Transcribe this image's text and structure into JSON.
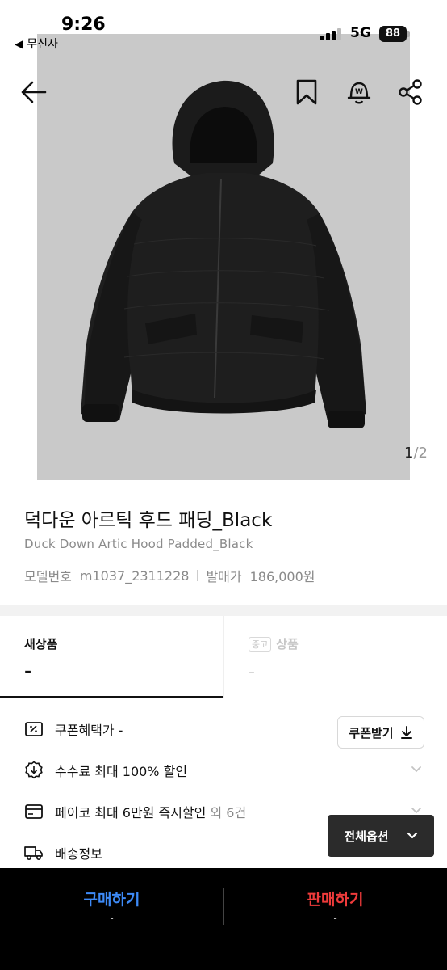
{
  "status_bar": {
    "time": "9:26",
    "back_app": "◀ 무신사",
    "network": "5G",
    "battery": "88"
  },
  "top_nav": {
    "back_icon": "arrow-left-icon",
    "bookmark_icon": "bookmark-icon",
    "alert_icon": "bell-w-icon",
    "share_icon": "share-icon"
  },
  "gallery": {
    "current": "1",
    "separator": "/",
    "total": "2"
  },
  "product": {
    "title": "덕다운 아르틱 후드 패딩_Black",
    "subtitle": "Duck Down Artic Hood Padded_Black",
    "model_label": "모델번호",
    "model_value": "m1037_2311228",
    "release_label": "발매가",
    "release_value": "186,000원"
  },
  "tabs": {
    "new": {
      "label": "새상품",
      "value": "-"
    },
    "used": {
      "tag": "중고",
      "label": "상품",
      "value": "-"
    }
  },
  "benefits": [
    {
      "icon": "coupon-icon",
      "text": "쿠폰혜택가 -",
      "extra": ""
    },
    {
      "icon": "discount-badge-icon",
      "text": "수수료 최대 100% 할인",
      "extra": ""
    },
    {
      "icon": "card-icon",
      "text": "페이코 최대 6만원 즉시할인",
      "extra": "외 6건"
    },
    {
      "icon": "truck-icon",
      "text": "배송정보",
      "extra": ""
    }
  ],
  "coupon_button": {
    "label": "쿠폰받기"
  },
  "options_button": {
    "label": "전체옵션"
  },
  "bottom_bar": {
    "buy_label": "구매하기",
    "buy_sub": "-",
    "sell_label": "판매하기",
    "sell_sub": "-"
  },
  "colors": {
    "buy": "#3d8af7",
    "sell": "#ef3b3b",
    "photo_bg": "#c9c9c9"
  }
}
